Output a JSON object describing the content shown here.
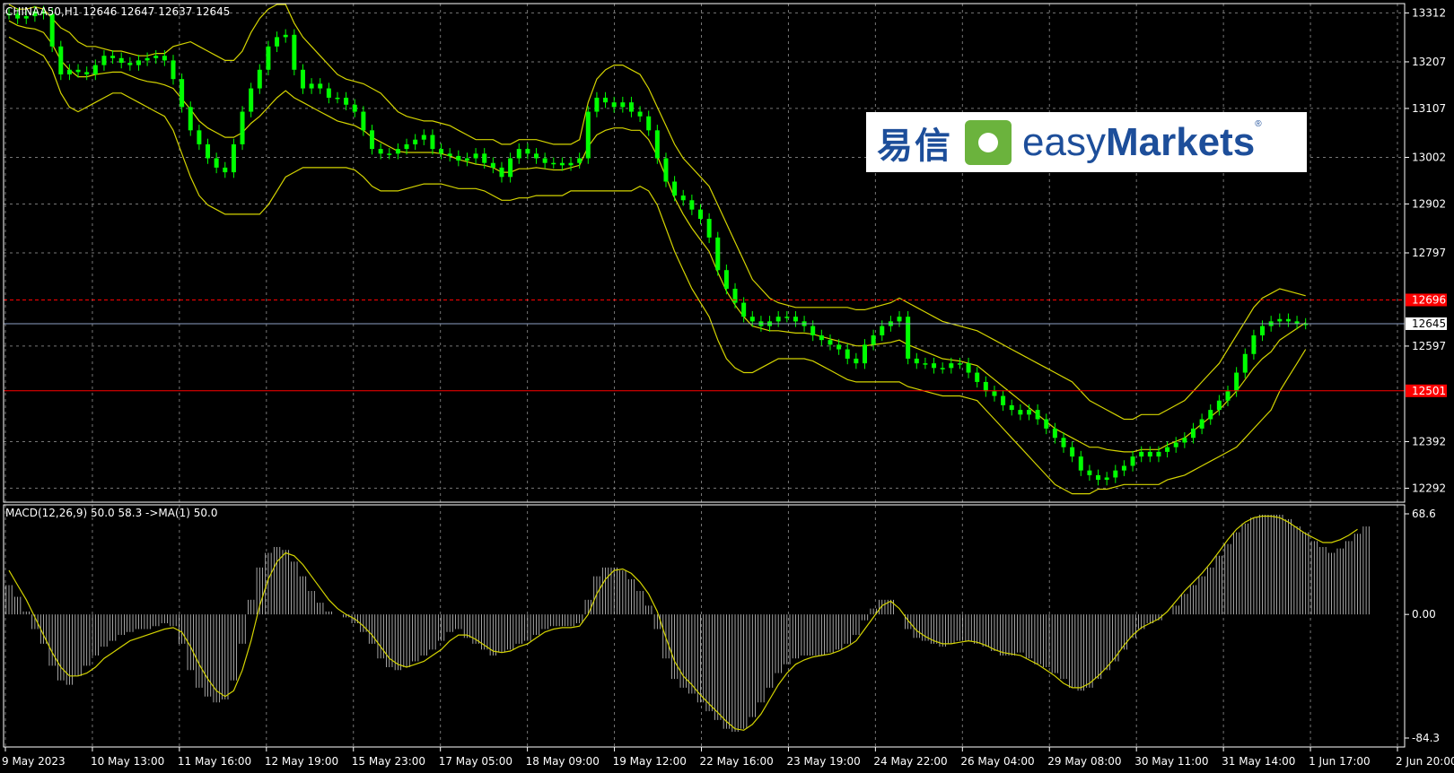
{
  "header": {
    "symbol_line": "CHINAA50,H1  12646 12647 12637 12645"
  },
  "macd_header": "MACD(12,26,9) 50.0 58.3  ->MA(1) 50.0",
  "logo": {
    "cn_text": "易信",
    "brand_light": "easy",
    "brand_bold": "Markets",
    "reg": "®"
  },
  "price_axis": {
    "ticks": [
      13312,
      13207,
      13107,
      13002,
      12902,
      12797,
      12597,
      12392,
      12292
    ],
    "range": [
      12262,
      13332
    ]
  },
  "macd_axis": {
    "ticks": [
      "68.6",
      "0.00",
      "-84.3"
    ],
    "range": [
      -84.3,
      68.6
    ]
  },
  "time_axis": [
    "9 May 2023",
    "10 May 13:00",
    "11 May 16:00",
    "12 May 19:00",
    "15 May 23:00",
    "17 May 05:00",
    "18 May 09:00",
    "19 May 12:00",
    "22 May 16:00",
    "23 May 19:00",
    "24 May 22:00",
    "26 May 04:00",
    "29 May 08:00",
    "30 May 11:00",
    "31 May 14:00",
    "1 Jun 17:00",
    "2 Jun 20:00"
  ],
  "levels": [
    {
      "value": 12696,
      "label": "12696",
      "color": "#ff0000",
      "style": "dashed"
    },
    {
      "value": 12645,
      "label": "12645",
      "color": "#8e9fc4",
      "style": "solid"
    },
    {
      "value": 12501,
      "label": "12501",
      "color": "#ff0000",
      "style": "solid"
    }
  ],
  "colors": {
    "candle": "#00ff00",
    "band": "#d4d400",
    "signal": "#d4d400",
    "histogram": "#cccccc",
    "grid": "#777777",
    "background": "#000000"
  },
  "chart_data": [
    {
      "type": "line",
      "name": "CHINAA50 H1 price with Bollinger Bands",
      "x": [
        0,
        1,
        2,
        3,
        4,
        5,
        6,
        7,
        8,
        9,
        10,
        11,
        12,
        13,
        14,
        15,
        16,
        17,
        18,
        19,
        20,
        21,
        22,
        23,
        24,
        25,
        26,
        27,
        28,
        29,
        30,
        31,
        32,
        33,
        34,
        35,
        36,
        37,
        38,
        39,
        40,
        41,
        42,
        43,
        44,
        45,
        46,
        47,
        48,
        49,
        50,
        51,
        52,
        53,
        54,
        55,
        56,
        57,
        58,
        59,
        60,
        61,
        62,
        63,
        64,
        65,
        66,
        67,
        68,
        69,
        70,
        71,
        72,
        73,
        74,
        75,
        76,
        77,
        78,
        79,
        80,
        81,
        82,
        83,
        84,
        85,
        86,
        87,
        88,
        89,
        90,
        91,
        92,
        93,
        94,
        95,
        96,
        97,
        98,
        99,
        100,
        101,
        102,
        103,
        104,
        105,
        106,
        107,
        108,
        109,
        110,
        111,
        112,
        113,
        114,
        115,
        116,
        117,
        118,
        119,
        120,
        121,
        122,
        123,
        124,
        125,
        126,
        127,
        128,
        129,
        130,
        131,
        132,
        133,
        134,
        135,
        136,
        137,
        138,
        139,
        140,
        141,
        142,
        143,
        144,
        145,
        146,
        147,
        148,
        149,
        150,
        151,
        152,
        153,
        154,
        155,
        156,
        157,
        158,
        159,
        160
      ],
      "price": [
        13310,
        13300,
        13305,
        13315,
        13310,
        13240,
        13180,
        13190,
        13185,
        13180,
        13200,
        13220,
        13215,
        13205,
        13200,
        13210,
        13215,
        13220,
        13210,
        13170,
        13110,
        13060,
        13030,
        13000,
        12980,
        12970,
        13030,
        13100,
        13150,
        13190,
        13240,
        13260,
        13265,
        13190,
        13150,
        13160,
        13150,
        13130,
        13130,
        13115,
        13100,
        13060,
        13020,
        13010,
        13010,
        13020,
        13030,
        13040,
        13050,
        13020,
        13010,
        13005,
        12995,
        13000,
        13010,
        12990,
        12980,
        12960,
        13000,
        13020,
        13010,
        13000,
        12990,
        12990,
        12985,
        12990,
        13000,
        13100,
        13130,
        13120,
        13110,
        13120,
        13100,
        13090,
        13060,
        13000,
        12950,
        12920,
        12910,
        12890,
        12870,
        12830,
        12760,
        12720,
        12690,
        12660,
        12650,
        12640,
        12650,
        12660,
        12660,
        12650,
        12640,
        12620,
        12610,
        12600,
        12590,
        12570,
        12560,
        12600,
        12620,
        12640,
        12650,
        12660,
        12570,
        12560,
        12560,
        12550,
        12550,
        12560,
        12560,
        12540,
        12520,
        12500,
        12490,
        12470,
        12460,
        12450,
        12460,
        12440,
        12420,
        12400,
        12380,
        12360,
        12330,
        12320,
        12310,
        12315,
        12330,
        12340,
        12360,
        12370,
        12360,
        12370,
        12380,
        12390,
        12400,
        12420,
        12440,
        12460,
        12480,
        12500,
        12540,
        12580,
        12620,
        12640,
        12650,
        12655,
        12650,
        12645,
        12645
      ],
      "bb_upper": [
        13330,
        13320,
        13320,
        13325,
        13320,
        13300,
        13280,
        13270,
        13250,
        13240,
        13240,
        13235,
        13230,
        13230,
        13225,
        13220,
        13220,
        13225,
        13225,
        13240,
        13245,
        13250,
        13240,
        13230,
        13220,
        13210,
        13210,
        13230,
        13270,
        13300,
        13320,
        13330,
        13330,
        13290,
        13260,
        13240,
        13220,
        13200,
        13180,
        13170,
        13165,
        13160,
        13150,
        13140,
        13120,
        13100,
        13090,
        13085,
        13080,
        13080,
        13075,
        13070,
        13060,
        13050,
        13040,
        13040,
        13040,
        13030,
        13030,
        13040,
        13040,
        13040,
        13035,
        13030,
        13030,
        13030,
        13040,
        13120,
        13170,
        13190,
        13200,
        13200,
        13190,
        13180,
        13150,
        13110,
        13070,
        13030,
        13000,
        12980,
        12960,
        12940,
        12900,
        12860,
        12820,
        12780,
        12740,
        12720,
        12700,
        12690,
        12685,
        12680,
        12680,
        12680,
        12680,
        12680,
        12680,
        12680,
        12675,
        12675,
        12680,
        12685,
        12690,
        12700,
        12690,
        12680,
        12670,
        12660,
        12650,
        12645,
        12640,
        12635,
        12630,
        12620,
        12610,
        12600,
        12590,
        12580,
        12570,
        12560,
        12550,
        12540,
        12530,
        12520,
        12500,
        12480,
        12470,
        12460,
        12450,
        12440,
        12440,
        12450,
        12450,
        12450,
        12460,
        12470,
        12480,
        12500,
        12520,
        12540,
        12560,
        12590,
        12620,
        12650,
        12680,
        12700,
        12710,
        12720,
        12715,
        12710,
        12705
      ],
      "bb_lower": [
        13260,
        13250,
        13240,
        13230,
        13220,
        13190,
        13140,
        13110,
        13100,
        13110,
        13120,
        13130,
        13140,
        13140,
        13130,
        13120,
        13110,
        13100,
        13090,
        13060,
        13010,
        12960,
        12920,
        12900,
        12890,
        12880,
        12880,
        12880,
        12880,
        12880,
        12900,
        12930,
        12960,
        12970,
        12980,
        12980,
        12980,
        12980,
        12980,
        12980,
        12975,
        12960,
        12940,
        12930,
        12930,
        12930,
        12935,
        12940,
        12945,
        12945,
        12945,
        12940,
        12935,
        12935,
        12935,
        12930,
        12920,
        12910,
        12910,
        12915,
        12915,
        12920,
        12920,
        12920,
        12920,
        12930,
        12930,
        12930,
        12930,
        12930,
        12930,
        12930,
        12930,
        12940,
        12930,
        12900,
        12850,
        12800,
        12760,
        12720,
        12690,
        12660,
        12610,
        12570,
        12550,
        12540,
        12540,
        12550,
        12560,
        12570,
        12570,
        12570,
        12570,
        12565,
        12555,
        12545,
        12535,
        12525,
        12520,
        12520,
        12520,
        12520,
        12520,
        12520,
        12510,
        12505,
        12500,
        12495,
        12490,
        12490,
        12490,
        12485,
        12480,
        12460,
        12440,
        12420,
        12400,
        12380,
        12360,
        12340,
        12320,
        12300,
        12290,
        12280,
        12280,
        12280,
        12290,
        12290,
        12295,
        12300,
        12300,
        12300,
        12300,
        12300,
        12310,
        12315,
        12320,
        12330,
        12340,
        12350,
        12360,
        12370,
        12380,
        12400,
        12420,
        12440,
        12460,
        12500,
        12530,
        12560,
        12590
      ]
    },
    {
      "type": "bar",
      "name": "MACD(12,26,9)",
      "x": [
        0,
        1,
        2,
        3,
        4,
        5,
        6,
        7,
        8,
        9,
        10,
        11,
        12,
        13,
        14,
        15,
        16,
        17,
        18,
        19,
        20,
        21,
        22,
        23,
        24,
        25,
        26,
        27,
        28,
        29,
        30,
        31,
        32,
        33,
        34,
        35,
        36,
        37,
        38,
        39,
        40,
        41,
        42,
        43,
        44,
        45,
        46,
        47,
        48,
        49,
        50,
        51,
        52,
        53,
        54,
        55,
        56,
        57,
        58,
        59,
        60,
        61,
        62,
        63,
        64,
        65,
        66,
        67,
        68,
        69,
        70,
        71,
        72,
        73,
        74,
        75,
        76,
        77,
        78,
        79,
        80,
        81,
        82,
        83,
        84,
        85,
        86,
        87,
        88,
        89,
        90,
        91,
        92,
        93,
        94,
        95,
        96,
        97,
        98,
        99,
        100,
        101,
        102,
        103,
        104,
        105,
        106,
        107,
        108,
        109,
        110,
        111,
        112,
        113,
        114,
        115,
        116,
        117,
        118,
        119,
        120,
        121,
        122,
        123,
        124,
        125,
        126,
        127,
        128,
        129,
        130,
        131,
        132,
        133,
        134,
        135,
        136,
        137,
        138,
        139,
        140,
        141,
        142,
        143,
        144,
        145,
        146,
        147,
        148,
        149,
        150,
        151,
        152,
        153,
        154,
        155,
        156,
        157,
        158,
        159,
        160
      ],
      "macd": [
        20,
        12,
        2,
        -10,
        -20,
        -35,
        -45,
        -48,
        -42,
        -35,
        -28,
        -22,
        -18,
        -14,
        -12,
        -10,
        -10,
        -8,
        -6,
        -8,
        -20,
        -38,
        -50,
        -56,
        -60,
        -58,
        -45,
        -20,
        10,
        32,
        42,
        46,
        44,
        36,
        26,
        16,
        8,
        2,
        0,
        -2,
        -6,
        -12,
        -20,
        -30,
        -36,
        -38,
        -36,
        -32,
        -28,
        -24,
        -18,
        -12,
        -10,
        -16,
        -20,
        -24,
        -28,
        -26,
        -24,
        -20,
        -18,
        -14,
        -10,
        -8,
        -8,
        -8,
        -6,
        10,
        26,
        32,
        32,
        30,
        24,
        16,
        6,
        -10,
        -30,
        -44,
        -50,
        -54,
        -60,
        -66,
        -72,
        -78,
        -80,
        -78,
        -70,
        -60,
        -50,
        -40,
        -34,
        -30,
        -28,
        -28,
        -28,
        -26,
        -24,
        -20,
        -14,
        -4,
        4,
        10,
        10,
        0,
        -10,
        -16,
        -18,
        -20,
        -22,
        -20,
        -18,
        -18,
        -20,
        -22,
        -25,
        -28,
        -28,
        -26,
        -30,
        -34,
        -36,
        -40,
        -44,
        -50,
        -52,
        -50,
        -44,
        -38,
        -32,
        -24,
        -16,
        -10,
        -6,
        -4,
        0,
        6,
        14,
        20,
        26,
        32,
        40,
        48,
        56,
        62,
        66,
        68,
        68,
        68,
        65,
        60,
        56,
        50,
        46,
        42,
        45,
        50,
        55,
        60
      ],
      "signal": [
        30,
        20,
        10,
        -2,
        -14,
        -26,
        -36,
        -42,
        -42,
        -40,
        -36,
        -30,
        -26,
        -22,
        -18,
        -16,
        -14,
        -12,
        -10,
        -9,
        -12,
        -22,
        -34,
        -44,
        -52,
        -56,
        -52,
        -38,
        -18,
        6,
        24,
        36,
        42,
        40,
        34,
        26,
        18,
        10,
        4,
        0,
        -3,
        -8,
        -14,
        -22,
        -30,
        -34,
        -36,
        -34,
        -32,
        -28,
        -24,
        -18,
        -14,
        -14,
        -17,
        -21,
        -25,
        -26,
        -25,
        -22,
        -20,
        -16,
        -12,
        -10,
        -9,
        -9,
        -8,
        0,
        14,
        24,
        30,
        31,
        28,
        22,
        14,
        2,
        -16,
        -32,
        -42,
        -48,
        -55,
        -61,
        -67,
        -73,
        -78,
        -79,
        -75,
        -68,
        -58,
        -48,
        -40,
        -34,
        -31,
        -29,
        -28,
        -27,
        -25,
        -22,
        -18,
        -10,
        -2,
        6,
        9,
        4,
        -4,
        -11,
        -15,
        -18,
        -20,
        -20,
        -19,
        -18,
        -19,
        -21,
        -24,
        -26,
        -27,
        -28,
        -31,
        -34,
        -38,
        -42,
        -47,
        -50,
        -50,
        -47,
        -42,
        -36,
        -29,
        -21,
        -14,
        -9,
        -6,
        -3,
        2,
        9,
        16,
        22,
        28,
        35,
        43,
        51,
        58,
        63,
        66,
        67,
        67,
        66,
        63,
        59,
        55,
        52,
        49,
        49,
        51,
        54,
        58
      ]
    }
  ]
}
